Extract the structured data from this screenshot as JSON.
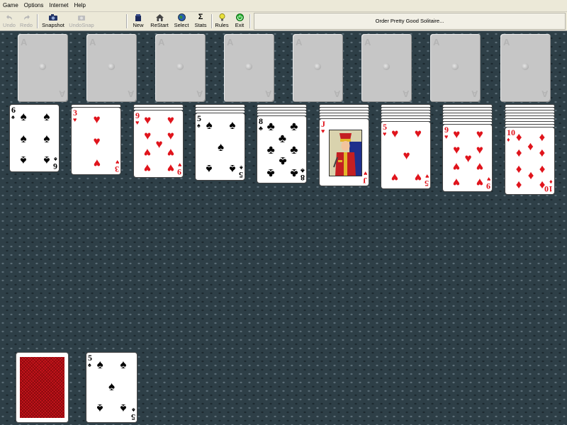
{
  "menu": [
    "Game",
    "Options",
    "Internet",
    "Help"
  ],
  "toolbar": {
    "undo": "Undo",
    "redo": "Redo",
    "snapshot": "Snapshot",
    "undosnap": "UndoSnap",
    "new": "New",
    "restart": "ReStart",
    "select": "Select",
    "stats": "Stats",
    "rules": "Rules",
    "exit": "Exit",
    "order": "Order Pretty Good Solitaire..."
  },
  "foundations": [
    {
      "label": "A"
    },
    {
      "label": "A"
    },
    {
      "label": "A"
    },
    {
      "label": "A"
    },
    {
      "label": "A"
    },
    {
      "label": "A"
    },
    {
      "label": "A"
    },
    {
      "label": "A"
    }
  ],
  "tableau": [
    {
      "rank": "6",
      "suit": "♠",
      "color": "black"
    },
    {
      "rank": "3",
      "suit": "♥",
      "color": "red"
    },
    {
      "rank": "9",
      "suit": "♥",
      "color": "red"
    },
    {
      "rank": "5",
      "suit": "♠",
      "color": "black"
    },
    {
      "rank": "8",
      "suit": "♣",
      "color": "black"
    },
    {
      "rank": "J",
      "suit": "♥",
      "color": "red"
    },
    {
      "rank": "5",
      "suit": "♥",
      "color": "red"
    },
    {
      "rank": "9",
      "suit": "♥",
      "color": "red"
    },
    {
      "rank": "10",
      "suit": "♦",
      "color": "red"
    }
  ],
  "waste": {
    "rank": "5",
    "suit": "♠",
    "color": "black"
  },
  "colors": {
    "felt": "#2e3f47",
    "red_suit": "#e0141c",
    "card_back": "#c8141c"
  }
}
